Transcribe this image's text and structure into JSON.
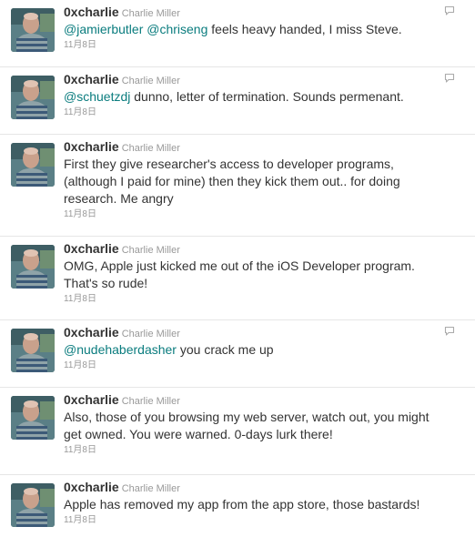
{
  "user": {
    "screen_name": "0xcharlie",
    "full_name": "Charlie Miller"
  },
  "tweets": [
    {
      "segments": [
        {
          "text": "@jamierbutler",
          "type": "mention"
        },
        {
          "text": " ",
          "type": "text"
        },
        {
          "text": "@chriseng",
          "type": "mention"
        },
        {
          "text": " feels heavy handed, I miss Steve.",
          "type": "text"
        }
      ],
      "timestamp": "11月8日",
      "has_reply_icon": true
    },
    {
      "segments": [
        {
          "text": "@schuetzdj",
          "type": "mention"
        },
        {
          "text": " dunno, letter of termination. Sounds permenant.",
          "type": "text"
        }
      ],
      "timestamp": "11月8日",
      "has_reply_icon": true
    },
    {
      "segments": [
        {
          "text": "First they give researcher's access to developer programs, (although I paid for mine) then they kick them out.. for doing research. Me angry",
          "type": "text"
        }
      ],
      "timestamp": "11月8日",
      "has_reply_icon": false
    },
    {
      "segments": [
        {
          "text": "OMG, Apple just kicked me out of the iOS Developer program. That's so rude!",
          "type": "text"
        }
      ],
      "timestamp": "11月8日",
      "has_reply_icon": false
    },
    {
      "segments": [
        {
          "text": "@nudehaberdasher",
          "type": "mention"
        },
        {
          "text": " you crack me up",
          "type": "text"
        }
      ],
      "timestamp": "11月8日",
      "has_reply_icon": true
    },
    {
      "segments": [
        {
          "text": "Also, those of you browsing my web server, watch out, you might get owned. You were warned. 0-days lurk there!",
          "type": "text"
        }
      ],
      "timestamp": "11月8日",
      "has_reply_icon": false
    },
    {
      "segments": [
        {
          "text": "Apple has removed my app from the app store, those bastards!",
          "type": "text"
        }
      ],
      "timestamp": "11月8日",
      "has_reply_icon": false
    }
  ],
  "icons": {
    "avatar": "profile-photo",
    "reply": "reply-speech-bubble-icon"
  },
  "colors": {
    "mention": "#0a7c7e",
    "text": "#333333",
    "meta": "#999999",
    "divider": "#e6e6e6"
  }
}
